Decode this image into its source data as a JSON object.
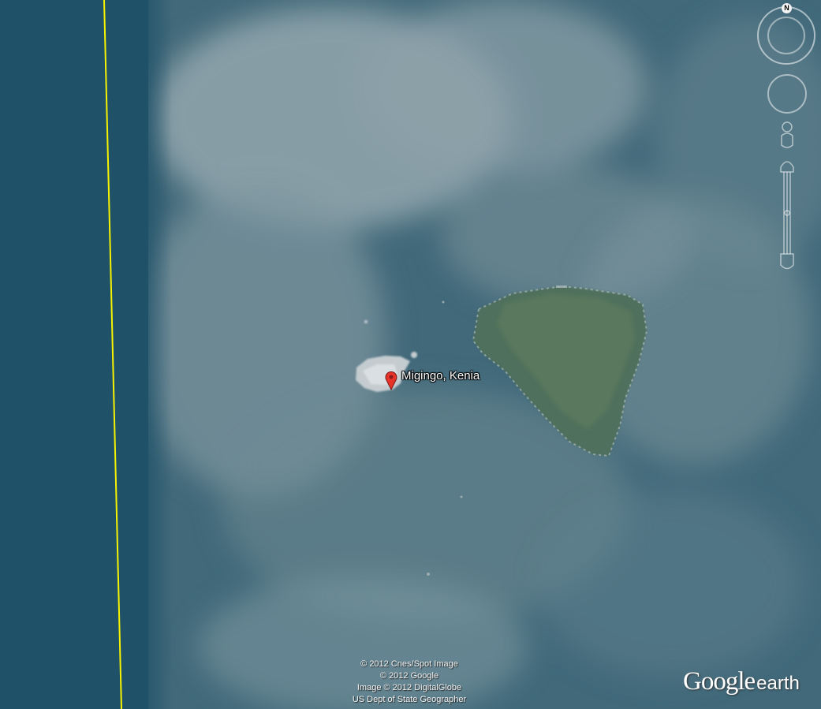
{
  "placemark": {
    "label": "Migingo, Kenia",
    "icon": "red-placemark-icon"
  },
  "attribution": {
    "lines": [
      "© 2012 Cnes/Spot Image",
      "© 2012 Google",
      "Image © 2012 DigitalGlobe",
      "US Dept of State Geographer"
    ]
  },
  "logo": {
    "google": "Google",
    "earth": "earth"
  },
  "navigation": {
    "north_label": "N"
  },
  "colors": {
    "deep_water": "#1f5168",
    "lake": "#3d6a7c",
    "haze": "#8fa4ad",
    "border_line": "#f7f200",
    "island": "#4f6e5a",
    "rock": "#c9d0d3",
    "placemark": "#e8332b"
  },
  "icons": [
    "red-placemark-icon",
    "compass-ring-icon",
    "look-joystick-icon",
    "street-view-pegman-icon",
    "zoom-slider-icon"
  ]
}
